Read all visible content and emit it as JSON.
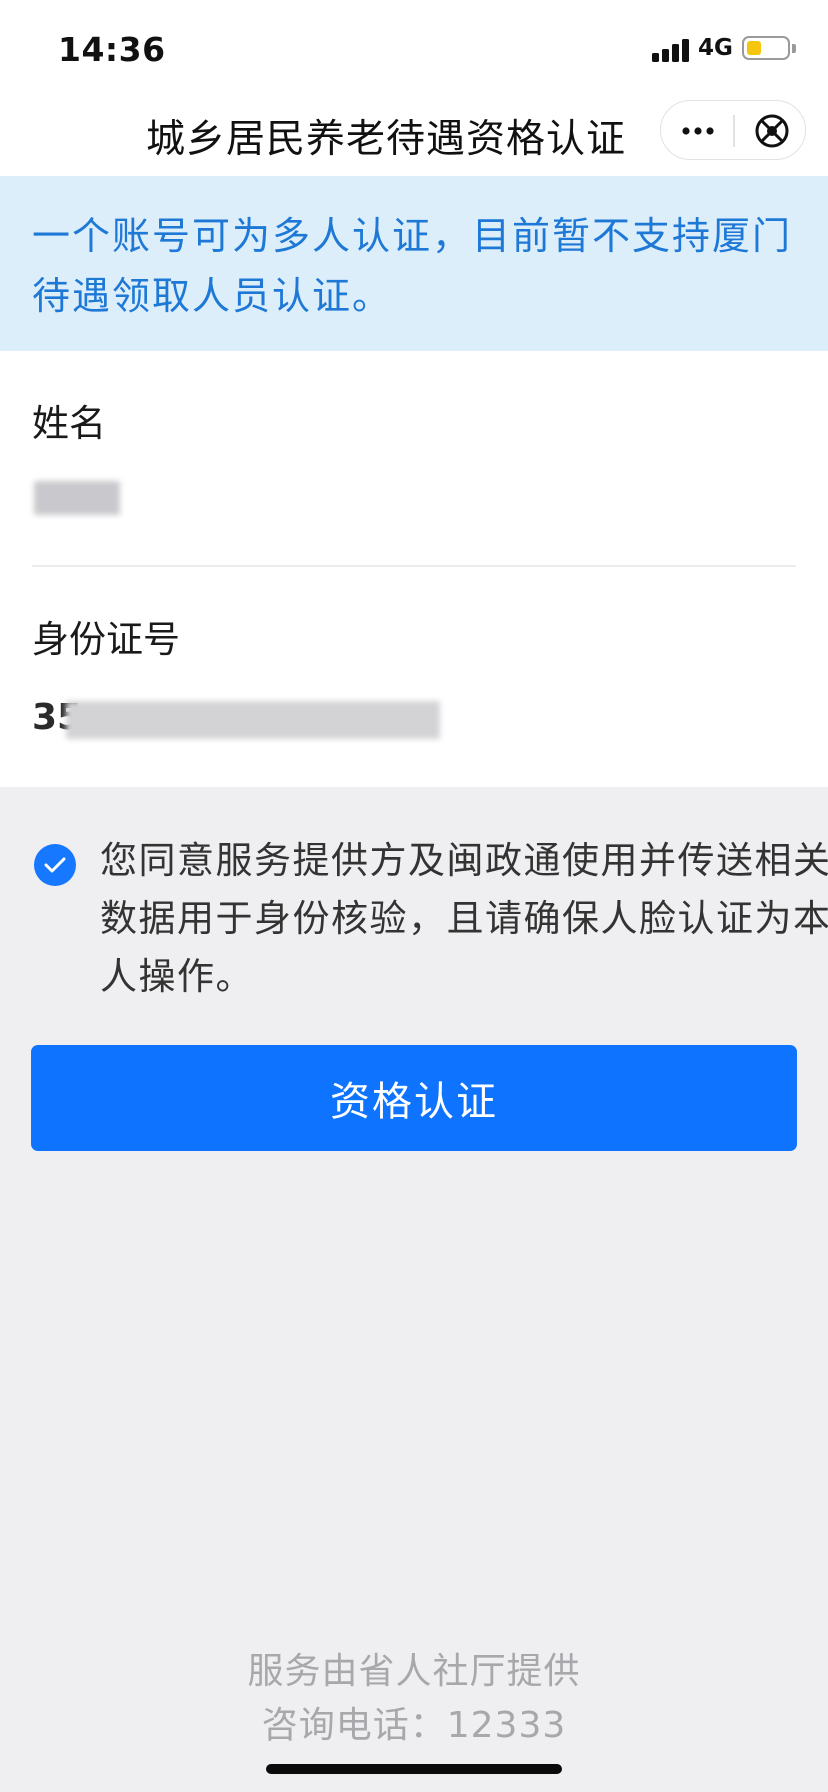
{
  "status_bar": {
    "time": "14:36",
    "network": "4G",
    "battery_level": 0.35,
    "battery_color": "#f4c60f"
  },
  "nav": {
    "title": "城乡居民养老待遇资格认证",
    "more_icon": "ellipsis-icon",
    "close_icon": "close-circle-icon"
  },
  "notice": {
    "text": "一个账号可为多人认证，目前暂不支持厦门待遇领取人员认证。",
    "background": "#ddeefb",
    "color": "#1e78d6"
  },
  "form": {
    "name_label": "姓名",
    "id_label": "身份证号",
    "id_value_visible": "35"
  },
  "agreement": {
    "checked": true,
    "text": "您同意服务提供方及闽政通使用并传送相关数据用于身份核验，且请确保人脸认证为本人操作。"
  },
  "primary_button": {
    "label": "资格认证",
    "color": "#0e74ff"
  },
  "footer": {
    "provider": "服务由省人社厅提供",
    "hotline": "咨询电话：12333"
  }
}
